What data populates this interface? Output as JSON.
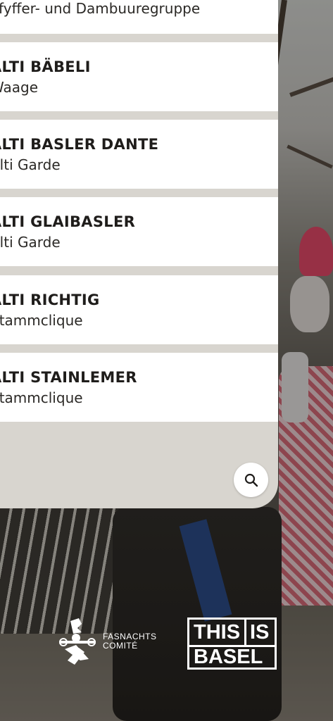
{
  "list": {
    "partial_top_subtitle": "Pfyffer- und Dambuuregruppe",
    "items": [
      {
        "name": "ALTI BÄBELI",
        "group": "Waage"
      },
      {
        "name": "ALTI BASLER DANTE",
        "group": "Alti Garde"
      },
      {
        "name": "ALTI GLAIBASLER",
        "group": "Alti Garde"
      },
      {
        "name": "ALTI RICHTIG",
        "group": "Stammclique"
      },
      {
        "name": "ALTI STAINLEMER",
        "group": "Stammclique"
      }
    ]
  },
  "search": {
    "icon": "search-icon"
  },
  "logos": {
    "fasnachts_comite": [
      "FASNACHTS",
      "COMITÉ"
    ],
    "this_is_basel": [
      "THIS",
      "IS",
      "BASEL"
    ]
  },
  "colors": {
    "panel_bg": "#d8d5cf",
    "card_bg": "#ffffff",
    "text": "#1f1d1b"
  }
}
